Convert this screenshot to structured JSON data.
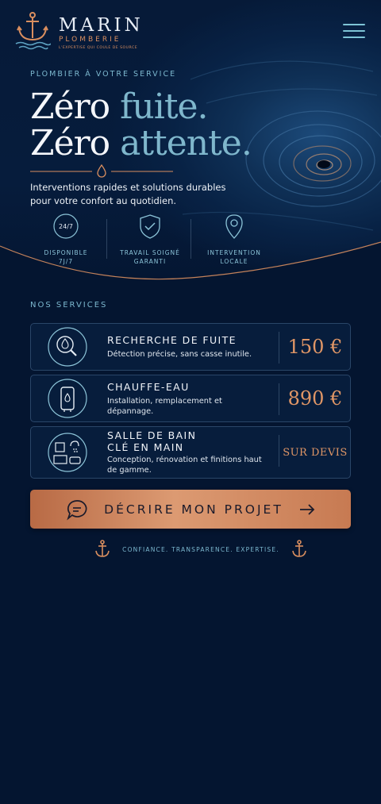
{
  "header": {
    "brand_name": "MARIN",
    "brand_sub": "PLOMBERIE",
    "brand_tagline": "L'EXPERTISE QUI COULE DE SOURCE"
  },
  "hero": {
    "eyebrow": "PLOMBIER À VOTRE SERVICE",
    "title_line1_a": "Zéro ",
    "title_line1_b": "fuite.",
    "title_line2_a": "Zéro ",
    "title_line2_b": "attente.",
    "lead": "Interventions rapides et solutions durables pour votre confort au quotidien."
  },
  "badges": [
    {
      "icon": "clock-24-7-icon",
      "badge_text": "24/7",
      "line1": "DISPONIBLE",
      "line2": "7J/7"
    },
    {
      "icon": "shield-check-icon",
      "line1": "TRAVAIL SOIGNÉ",
      "line2": "GARANTI"
    },
    {
      "icon": "location-pin-icon",
      "line1": "INTERVENTION",
      "line2": "LOCALE"
    }
  ],
  "services": {
    "section_title": "NOS SERVICES",
    "items": [
      {
        "icon": "leak-search-icon",
        "title": "RECHERCHE DE FUITE",
        "desc": "Détection précise, sans casse inutile.",
        "price": "150 €"
      },
      {
        "icon": "water-heater-icon",
        "title": "CHAUFFE-EAU",
        "desc": "Installation, remplacement et dépannage.",
        "price": "890 €"
      },
      {
        "icon": "bathroom-icon",
        "title": "SALLE DE BAIN CLÉ EN MAIN",
        "desc": "Conception, rénovation et finitions haut de gamme.",
        "price": "SUR DEVIS"
      }
    ]
  },
  "cta": {
    "label": "DÉCRIRE MON PROJET",
    "icon": "chat-bubble-icon"
  },
  "footer": {
    "text": "CONFIANCE. TRANSPARENCE. EXPERTISE."
  },
  "colors": {
    "background": "#041530",
    "accent_copper": "#d98e5f",
    "accent_teal": "#7fb7cc"
  }
}
